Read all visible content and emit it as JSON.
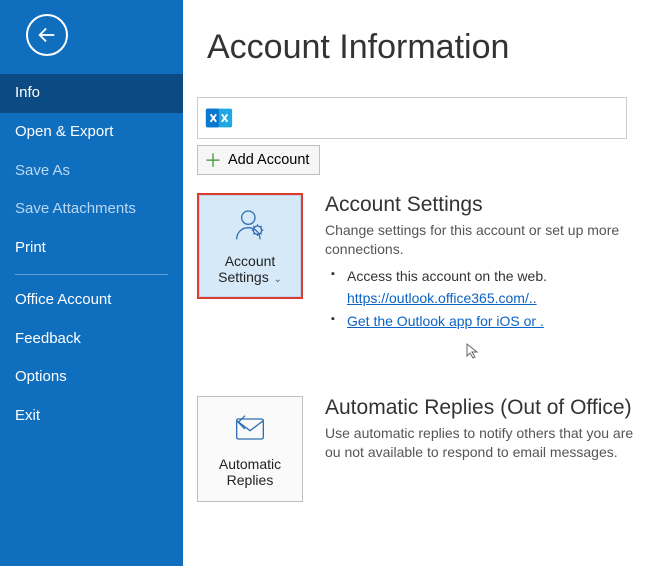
{
  "sidebar": {
    "items": [
      {
        "label": "Info",
        "state": "selected"
      },
      {
        "label": "Open & Export",
        "state": "normal"
      },
      {
        "label": "Save As",
        "state": "disabled"
      },
      {
        "label": "Save Attachments",
        "state": "disabled"
      },
      {
        "label": "Print",
        "state": "normal"
      }
    ],
    "lower": [
      {
        "label": "Office Account"
      },
      {
        "label": "Feedback"
      },
      {
        "label": "Options"
      },
      {
        "label": "Exit"
      }
    ]
  },
  "page": {
    "title": "Account Information"
  },
  "add_account": {
    "label": "Add Account"
  },
  "account_settings": {
    "tile_label": "Account Settings",
    "heading": "Account Settings",
    "desc": "Change settings for this account or set up more connections.",
    "bullets": [
      {
        "text": "Access this account on the web."
      },
      {
        "link": "https://outlook.office365.com/.."
      },
      {
        "link": "Get the Outlook app for iOS or ."
      }
    ]
  },
  "auto_replies": {
    "tile_label": "Automatic Replies",
    "heading": "Automatic Replies (Out of Office)",
    "desc": "Use automatic replies to notify others that you are ou not available to respond to email messages."
  }
}
